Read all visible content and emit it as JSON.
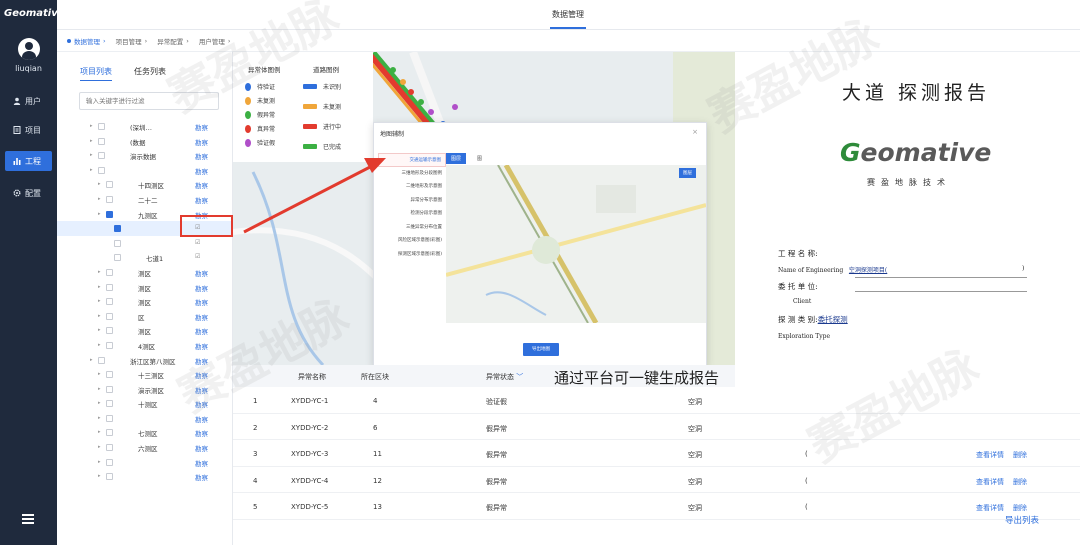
{
  "app": {
    "logo": "Geomative",
    "username": "liuqian"
  },
  "nav": [
    {
      "label": "用户",
      "icon": "user-icon"
    },
    {
      "label": "项目",
      "icon": "document-icon"
    },
    {
      "label": "工程",
      "icon": "bar-chart-icon",
      "active": true
    },
    {
      "label": "配置",
      "icon": "gear-icon"
    }
  ],
  "topbar": {
    "title": "数据管理"
  },
  "breadcrumbs": [
    "数据管理",
    "项目管理",
    "异常配置",
    "用户管理"
  ],
  "tree": {
    "tabs": [
      "项目列表",
      "任务列表"
    ],
    "search_placeholder": "输入关键字进行过滤",
    "action_label": "勘察",
    "rows": [
      {
        "label": "(深圳…",
        "action": "勘察"
      },
      {
        "label": "(数据",
        "action": "勘察"
      },
      {
        "label": "演示数据",
        "action": "勘察"
      },
      {
        "label": "",
        "action": "勘察"
      },
      {
        "label": "十四测区",
        "action": "勘察"
      },
      {
        "label": "二十二",
        "action": "勘察"
      },
      {
        "label": "九测区",
        "action": "勘察"
      },
      {
        "label": "",
        "action": "☑",
        "selected": true
      },
      {
        "label": "",
        "action": "☑"
      },
      {
        "label": "七道1",
        "action": "☑"
      },
      {
        "label": "测区",
        "action": "勘察"
      },
      {
        "label": "测区",
        "action": "勘察"
      },
      {
        "label": "测区",
        "action": "勘察"
      },
      {
        "label": "区",
        "action": "勘察"
      },
      {
        "label": "测区",
        "action": "勘察"
      },
      {
        "label": "4测区",
        "action": "勘察"
      },
      {
        "label": "浙江区第八测区",
        "action": "勘察"
      },
      {
        "label": "十三测区",
        "action": "勘察"
      },
      {
        "label": "演示测区",
        "action": "勘察"
      },
      {
        "label": "十测区",
        "action": "勘察"
      },
      {
        "label": "",
        "action": "勘察"
      },
      {
        "label": "七测区",
        "action": "勘察"
      },
      {
        "label": "六测区",
        "action": "勘察"
      },
      {
        "label": "",
        "action": "勘察"
      },
      {
        "label": "",
        "action": "勘察"
      }
    ]
  },
  "legend": {
    "abnormal_title": "异常体图例",
    "road_title": "道路图例",
    "abnormal": [
      {
        "label": "待验证",
        "color": "#2f6fdc"
      },
      {
        "label": "未复测",
        "color": "#f0a63a"
      },
      {
        "label": "假异常",
        "color": "#3cb043"
      },
      {
        "label": "真异常",
        "color": "#e23b2e"
      },
      {
        "label": "验证假",
        "color": "#b04fc9"
      }
    ],
    "road": [
      {
        "label": "未识别",
        "color": "#2f6fdc"
      },
      {
        "label": "未复测",
        "color": "#f0a63a"
      },
      {
        "label": "进行中",
        "color": "#e23b2e"
      },
      {
        "label": "已完成",
        "color": "#3cb043"
      }
    ]
  },
  "modal": {
    "title": "地图辅制",
    "close": "×",
    "list": [
      "交通运输示意图",
      "三维地形及分段图例",
      "二维地形及示意图",
      "异常分布示意图",
      "检测分段示意图",
      "三维异常分布位置",
      "风险区域示意图(彩图)",
      "探测区域示意图(彩图)"
    ],
    "tabs": [
      "图层",
      "图"
    ],
    "map_button": "图层",
    "confirm_button": "导出地图"
  },
  "report": {
    "title": "大道 探测报告",
    "logo_g": "G",
    "logo_rest": "eomative",
    "subtitle": "赛盈地脉技术",
    "field1_cn": "工  程  名  称:",
    "field1_en": "Name of Engineering",
    "field1_value": "空洞探测项目(",
    "field1_tail": ")",
    "field2_cn": "委  托  单  位:",
    "field2_en": "Client",
    "field3_cn": "探  测  类  别:",
    "field3_value": "委托探测",
    "field3_en": "Exploration Type"
  },
  "caption": "通过平台可一键生成报告",
  "table": {
    "headers": [
      "异常名称",
      "所在区块",
      "异常状态"
    ],
    "rows": [
      {
        "index": "1",
        "name": "XYDD-YC-1",
        "block": "4",
        "status": "验证假",
        "type": "空洞",
        "extra": "",
        "detail": "",
        "delete": ""
      },
      {
        "index": "2",
        "name": "XYDD-YC-2",
        "block": "6",
        "status": "假异常",
        "type": "空洞",
        "extra": "",
        "detail": "",
        "delete": ""
      },
      {
        "index": "3",
        "name": "XYDD-YC-3",
        "block": "11",
        "status": "假异常",
        "type": "空洞",
        "extra": "(",
        "detail": "查看详情",
        "delete": "删除"
      },
      {
        "index": "4",
        "name": "XYDD-YC-4",
        "block": "12",
        "status": "假异常",
        "type": "空洞",
        "extra": "(",
        "detail": "查看详情",
        "delete": "删除"
      },
      {
        "index": "5",
        "name": "XYDD-YC-5",
        "block": "13",
        "status": "假异常",
        "type": "空洞",
        "extra": "(",
        "detail": "查看详情",
        "delete": "删除"
      }
    ],
    "export": "导出列表"
  },
  "watermark": "赛盈地脉"
}
